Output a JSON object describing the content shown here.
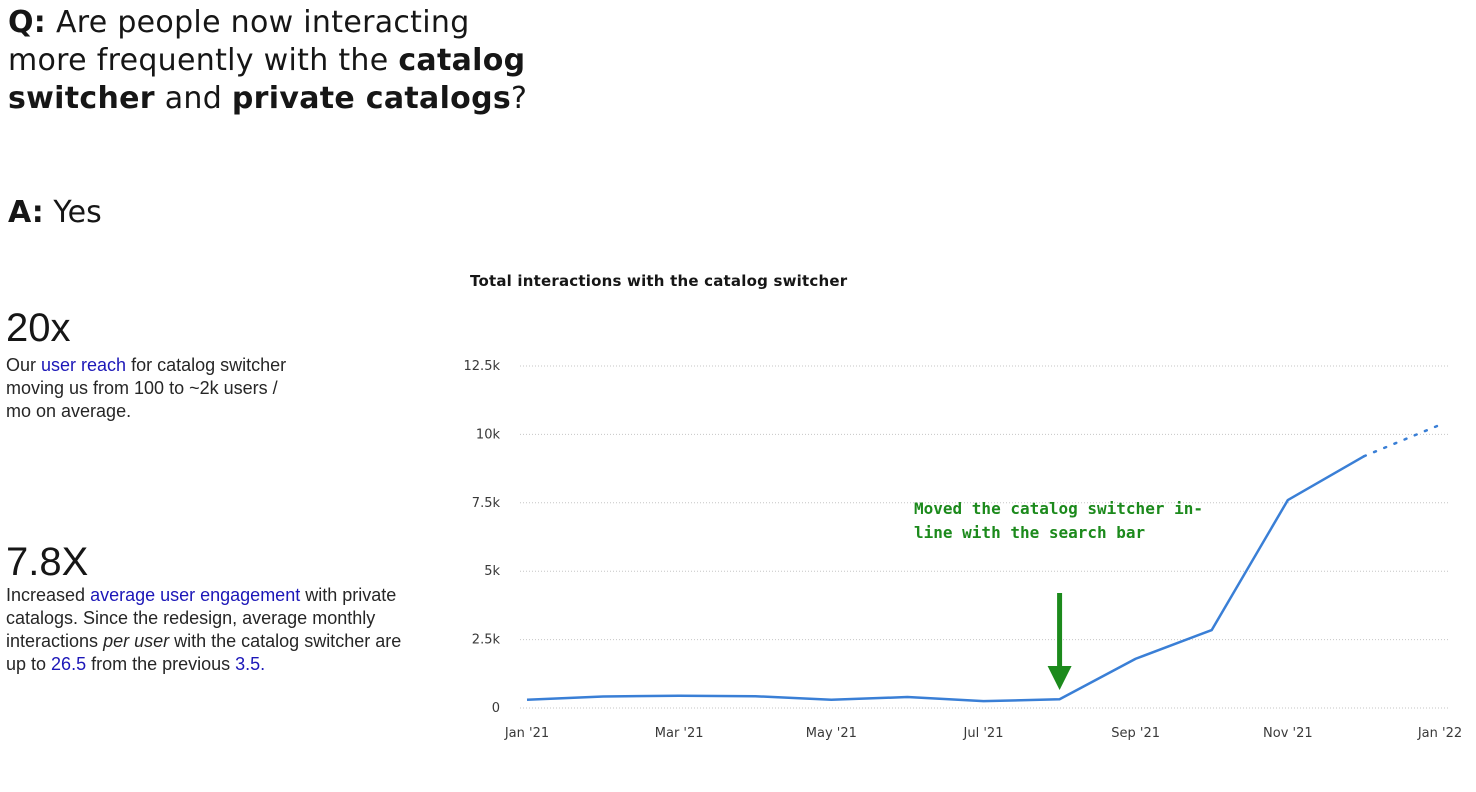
{
  "question": {
    "prefix": "Q:",
    "text_1": " Are people now interacting more frequently with the ",
    "bold_1": "catalog switcher",
    "text_2": " and ",
    "bold_2": "private catalogs",
    "text_3": "?"
  },
  "answer": {
    "prefix": "A:",
    "text": " Yes"
  },
  "stats": [
    {
      "big": "20x",
      "pre": "Our ",
      "highlight": "user reach",
      "post": " for catalog switcher moving us from 100 to ~2k users / mo on average."
    },
    {
      "big": "7.8X",
      "pre": "Increased ",
      "highlight": "average user engagement",
      "mid": " with private catalogs. Since the redesign, average monthly interactions ",
      "italic": "per user",
      "mid2": " with the catalog switcher are up to ",
      "val1": "26.5",
      "mid3": " from the previous ",
      "val2": "3.5."
    }
  ],
  "chart_data": {
    "type": "line",
    "title": "Total interactions with the catalog switcher",
    "xlabel": "",
    "ylabel": "",
    "x_tick_labels": [
      "Jan '21",
      "Mar '21",
      "May '21",
      "Jul '21",
      "Sep '21",
      "Nov '21",
      "Jan '22"
    ],
    "y_tick_labels": [
      "0",
      "2.5k",
      "5k",
      "7.5k",
      "10k",
      "12.5k"
    ],
    "ylim": [
      0,
      12500
    ],
    "x": [
      "Jan '21",
      "Feb '21",
      "Mar '21",
      "Apr '21",
      "May '21",
      "Jun '21",
      "Jul '21",
      "Aug '21",
      "Sep '21",
      "Oct '21",
      "Nov '21",
      "Dec '21",
      "Jan '22"
    ],
    "series": [
      {
        "values": [
          300,
          420,
          450,
          430,
          300,
          400,
          250,
          320,
          1800,
          2850,
          7600,
          9200,
          10350
        ],
        "projected_from_index": 11,
        "color": "#3a7fd6"
      }
    ],
    "grid": true,
    "annotation": {
      "text": "Moved the catalog switcher in-line with the search bar",
      "points_to": "Aug '21",
      "color": "#1c8a1c"
    }
  }
}
